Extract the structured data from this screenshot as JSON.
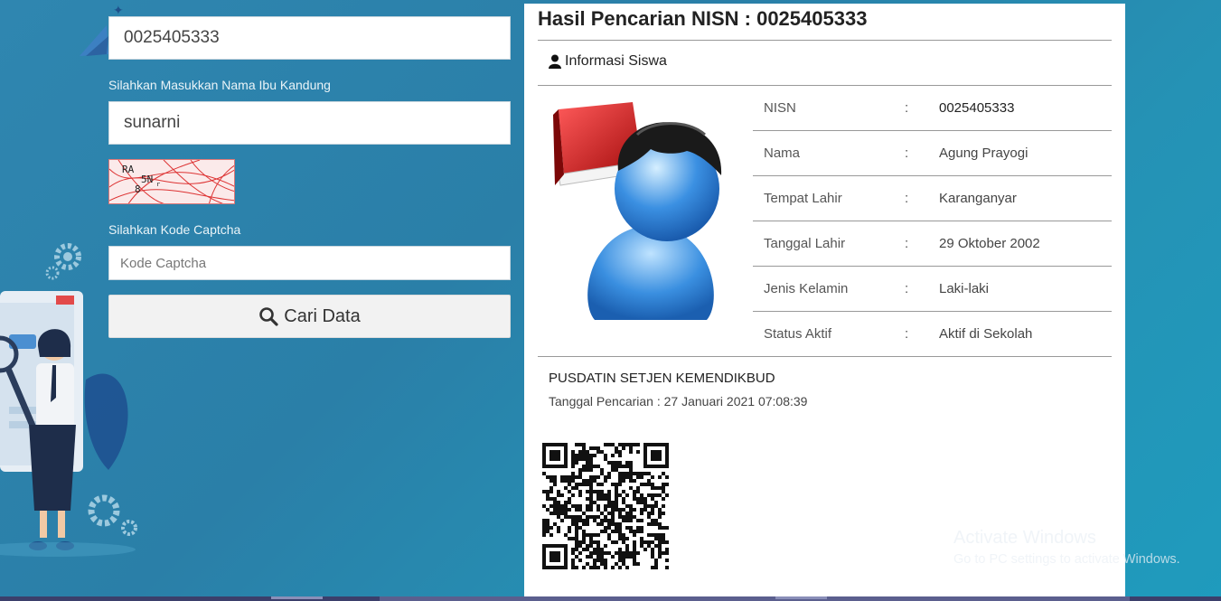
{
  "form": {
    "nisn_value": "0025405333",
    "mother_label": "Silahkan Masukkan Nama Ibu Kandung",
    "mother_value": "sunarni",
    "captcha_text": "RA 5N 8",
    "captcha_label": "Silahkan Kode Captcha",
    "captcha_placeholder": "Kode Captcha",
    "search_button": "Cari Data"
  },
  "result": {
    "title": "Hasil Pencarian NISN : 0025405333",
    "section_label": "Informasi Siswa",
    "rows": [
      {
        "key": "NISN",
        "sep": ":",
        "value": "0025405333"
      },
      {
        "key": "Nama",
        "sep": ":",
        "value": "Agung Prayogi"
      },
      {
        "key": "Tempat Lahir",
        "sep": ":",
        "value": "Karanganyar"
      },
      {
        "key": "Tanggal Lahir",
        "sep": ":",
        "value": "29 Oktober 2002"
      },
      {
        "key": "Jenis Kelamin",
        "sep": ":",
        "value": "Laki-laki"
      },
      {
        "key": "Status Aktif",
        "sep": ":",
        "value": "Aktif di Sekolah"
      }
    ],
    "org": "PUSDATIN SETJEN KEMENDIKBUD",
    "search_date": "Tanggal Pencarian : 27 Januari 2021 07:08:39"
  },
  "watermark": {
    "line1": "Activate Windows",
    "line2": "Go to PC settings to activate Windows."
  },
  "icons": {
    "search": "search-icon",
    "user": "user-icon",
    "avatar": "student-avatar-icon",
    "qr": "qr-code"
  },
  "colors": {
    "background": "#2a84ad",
    "panel": "#ffffff",
    "button": "#f2f2f2"
  }
}
